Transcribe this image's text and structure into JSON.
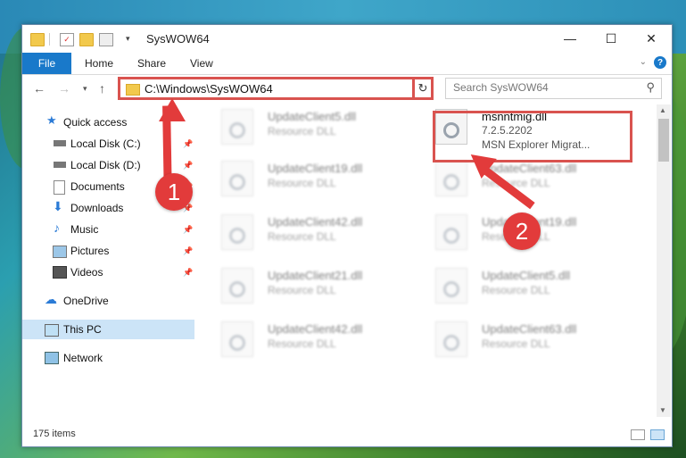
{
  "window": {
    "title": "SysWOW64"
  },
  "ribbon": {
    "file_tab": "File",
    "tabs": [
      "Home",
      "Share",
      "View"
    ]
  },
  "address": {
    "path": "C:\\Windows\\SysWOW64"
  },
  "search": {
    "placeholder": "Search SysWOW64"
  },
  "sidebar": {
    "items": [
      {
        "label": "Quick access"
      },
      {
        "label": "Local Disk (C:)"
      },
      {
        "label": "Local Disk (D:)"
      },
      {
        "label": "Documents"
      },
      {
        "label": "Downloads"
      },
      {
        "label": "Music"
      },
      {
        "label": "Pictures"
      },
      {
        "label": "Videos"
      },
      {
        "label": "OneDrive"
      },
      {
        "label": "This PC"
      },
      {
        "label": "Network"
      }
    ]
  },
  "files": {
    "left": [
      {
        "name": "UpdateClient5.dll",
        "type": "Resource DLL"
      },
      {
        "name": "UpdateClient19.dll",
        "type": "Resource DLL"
      },
      {
        "name": "UpdateClient42.dll",
        "type": "Resource DLL"
      },
      {
        "name": "UpdateClient21.dll",
        "type": "Resource DLL"
      },
      {
        "name": "UpdateClient42.dll",
        "type": "Resource DLL"
      }
    ],
    "right": [
      {
        "name": "UpdateClient63.dll",
        "type": "Resource DLL"
      },
      {
        "name": "UpdateClient19.dll",
        "type": "Resource DLL"
      },
      {
        "name": "UpdateClient5.dll",
        "type": "Resource DLL"
      },
      {
        "name": "UpdateClient63.dll",
        "type": "Resource DLL"
      }
    ],
    "highlighted": {
      "name": "msnntmig.dll",
      "version": "7.2.5.2202",
      "description": "MSN Explorer Migrat..."
    }
  },
  "status": {
    "items": "175 items"
  },
  "callouts": {
    "one": "1",
    "two": "2"
  },
  "colors": {
    "accent": "#1979ca",
    "callout": "#e23b3b",
    "selection": "#cce4f7"
  }
}
